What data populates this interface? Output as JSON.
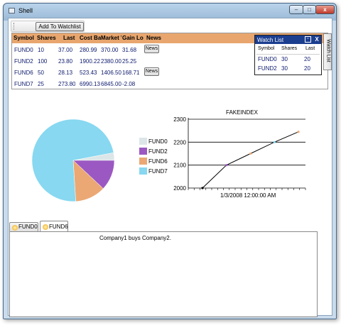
{
  "window": {
    "title": "Shell",
    "min_glyph": "–",
    "max_glyph": "□",
    "close_glyph": "x"
  },
  "toolbar": {
    "add_watchlist_label": "Add To Watchlist"
  },
  "grid": {
    "columns": [
      "Symbol",
      "Shares",
      "Last",
      "Cost Basis",
      "Market Value",
      "Gain Loss %",
      "News"
    ],
    "news_label": "News",
    "rows": [
      {
        "symbol": "FUND0",
        "shares": "10",
        "last": "37.00",
        "cost": "280.99",
        "market": "370.00",
        "gain": "31.68",
        "has_news": true
      },
      {
        "symbol": "FUND2",
        "shares": "100",
        "last": "23.80",
        "cost": "1900.22",
        "market": "2380.00",
        "gain": "25.25",
        "has_news": false
      },
      {
        "symbol": "FUND6",
        "shares": "50",
        "last": "28.13",
        "cost": "523.43",
        "market": "1406.50",
        "gain": "168.71",
        "has_news": true
      },
      {
        "symbol": "FUND7",
        "shares": "25",
        "last": "273.80",
        "cost": "6990.13",
        "market": "6845.00",
        "gain": "-2.08",
        "has_news": false
      }
    ]
  },
  "watch_list": {
    "title": "Watch List",
    "tab_label": "Watch List",
    "pin_glyph": "▫",
    "close_glyph": "X",
    "columns": [
      "Symbol",
      "Shares",
      "Last"
    ],
    "rows": [
      {
        "symbol": "FUND0",
        "shares": "30",
        "last": "20"
      },
      {
        "symbol": "FUND2",
        "shares": "30",
        "last": "20"
      }
    ]
  },
  "chart_data": [
    {
      "type": "pie",
      "categories": [
        "FUND0",
        "FUND2",
        "FUND6",
        "FUND7"
      ],
      "values": [
        3,
        12,
        12,
        73
      ],
      "colors": [
        "#dce6e8",
        "#9b58c2",
        "#eba874",
        "#87d8f0"
      ],
      "legend_position": "right"
    },
    {
      "type": "line",
      "title": "FAKEINDEX",
      "x_tick_label": "1/3/2008 12:00:00 AM",
      "ylim": [
        2000,
        2300
      ],
      "yticks": [
        2000,
        2100,
        2200,
        2300
      ],
      "grid": "horizontal",
      "x": [
        0,
        1,
        2,
        3,
        4
      ],
      "values": [
        2000,
        2100,
        2150,
        2200,
        2245
      ],
      "point_colors": [
        "#000000",
        "#9b58c2",
        "#eba874",
        "#87d8f0",
        "#eba874"
      ]
    }
  ],
  "tabs": [
    {
      "label": "FUND0",
      "active": false
    },
    {
      "label": "FUND6",
      "active": true
    }
  ],
  "news_text": "Company1 buys Company2."
}
